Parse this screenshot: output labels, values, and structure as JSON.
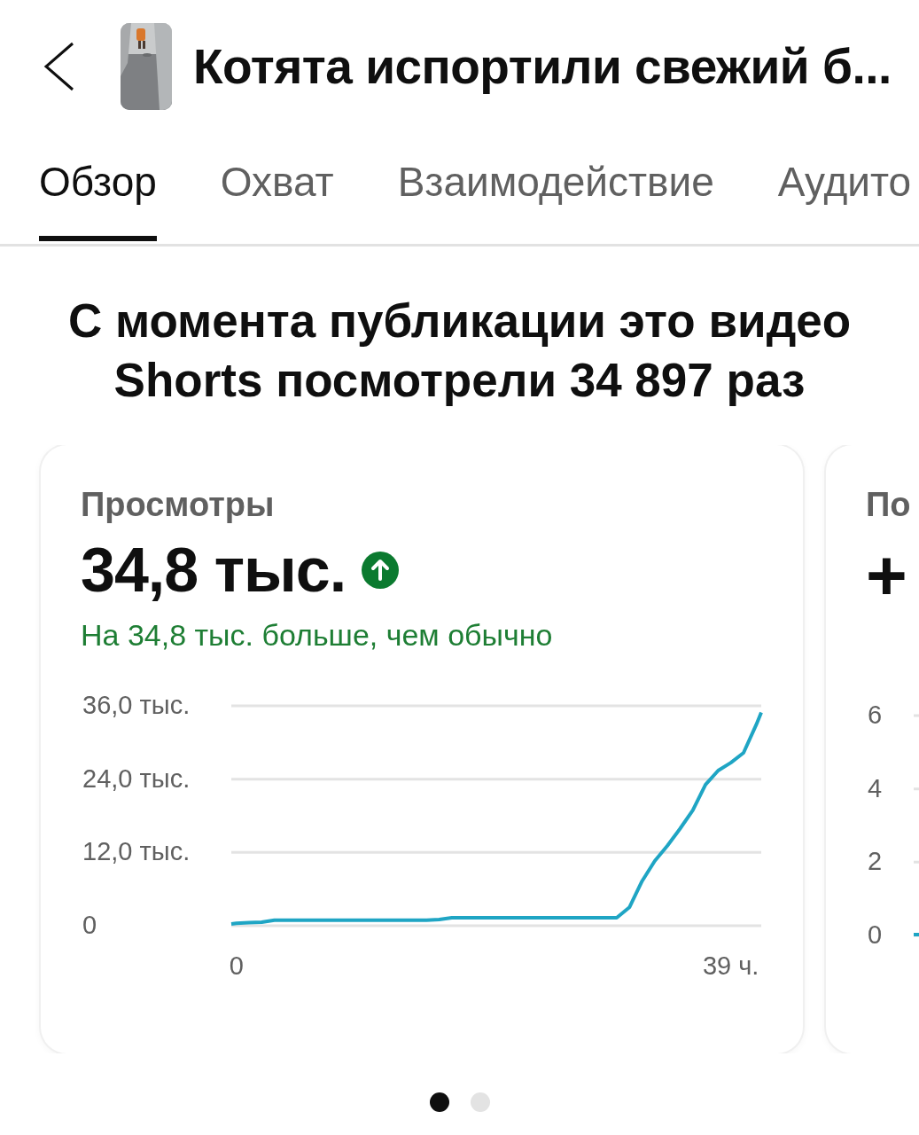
{
  "header": {
    "title": "Котята испортили свежий б..."
  },
  "tabs": [
    {
      "label": "Обзор",
      "selected": true
    },
    {
      "label": "Охват",
      "selected": false
    },
    {
      "label": "Взаимодействие",
      "selected": false
    },
    {
      "label": "Аудито",
      "selected": false
    }
  ],
  "summary": "С момента публикации это видео Shorts посмотрели 34 897 раз",
  "cards": [
    {
      "title": "Просмотры",
      "value": "34,8 тыс.",
      "trend_up": true,
      "comparison": "На 34,8 тыс. больше, чем обычно",
      "chart_data": {
        "type": "line",
        "x": [
          -0.4,
          0,
          1,
          2,
          3,
          4,
          5,
          6,
          7,
          8,
          9,
          10,
          11,
          12,
          13,
          14,
          15,
          16,
          17,
          18,
          19,
          20,
          21,
          22,
          23,
          24,
          25,
          26,
          27,
          28,
          29,
          30,
          31,
          32,
          33,
          34,
          35,
          36,
          37,
          38,
          39,
          40,
          41,
          41.4
        ],
        "series": [
          {
            "color": "#1fa5c4",
            "values": [
              0.3,
              0.4,
              0.5,
              0.6,
              0.9,
              0.9,
              0.9,
              0.9,
              0.9,
              0.9,
              0.9,
              0.9,
              0.9,
              0.9,
              0.9,
              0.9,
              0.9,
              1.0,
              1.3,
              1.3,
              1.3,
              1.3,
              1.3,
              1.3,
              1.3,
              1.3,
              1.3,
              1.3,
              1.3,
              1.3,
              1.3,
              1.3,
              3.0,
              7.3,
              10.6,
              13.1,
              15.9,
              18.9,
              23.1,
              25.4,
              26.7,
              28.3,
              32.9,
              34.9
            ]
          }
        ],
        "xlim": [
          -0.4,
          41.4
        ],
        "ylim": [
          0,
          36
        ],
        "xticks": [
          {
            "value": 0,
            "label": "0"
          },
          {
            "value": 39,
            "label": "39 ч."
          }
        ],
        "yticks": [
          {
            "value": 0,
            "label": "0"
          },
          {
            "value": 12,
            "label": "12,0 тыс."
          },
          {
            "value": 24,
            "label": "24,0 тыс."
          },
          {
            "value": 36,
            "label": "36,0 тыс."
          }
        ]
      }
    },
    {
      "title": "По",
      "value": "+",
      "y_tick_labels": [
        "6",
        "4",
        "2",
        "0"
      ]
    }
  ],
  "pager": [
    {
      "selected": true
    },
    {
      "selected": false
    }
  ]
}
